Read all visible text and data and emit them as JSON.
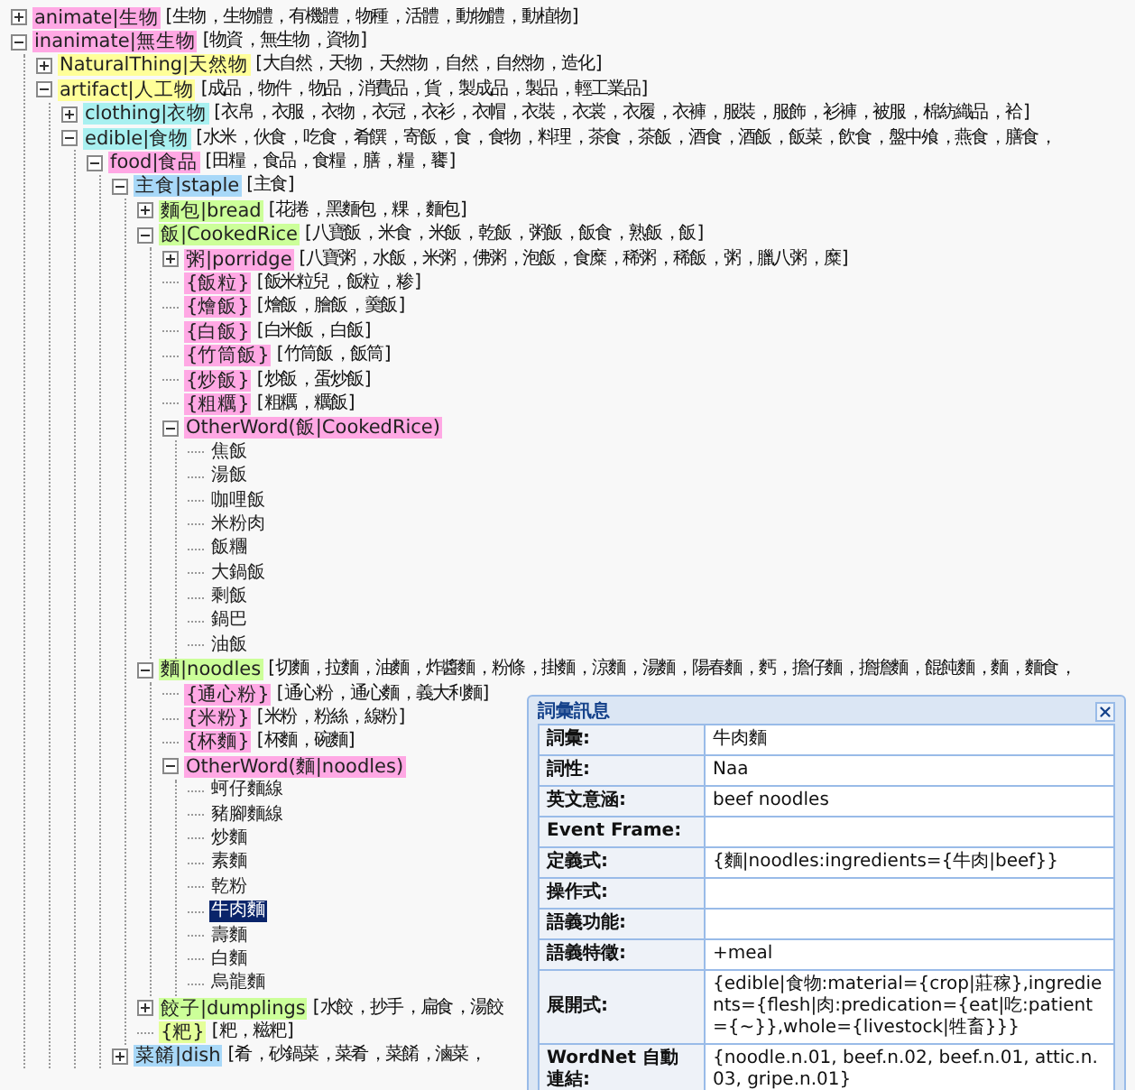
{
  "tree": [
    {
      "kind": "branch",
      "head": "animate|生物",
      "color": "#ffa8e4",
      "synonyms": "[ 生物 ，生物體 ，有機體 ，物種 ，活體 ，動物體 ，動植物 ]",
      "expanded": false,
      "selected": false
    },
    {
      "kind": "branch",
      "head": "inanimate|無生物",
      "color": "#ffa8e4",
      "synonyms": "[ 物資 ，無生物 ，資物 ]",
      "expanded": true,
      "selected": false,
      "children": [
        {
          "kind": "branch",
          "head": "NaturalThing|天然物",
          "color": "#ffff99",
          "synonyms": "[ 大自然 ，天物 ，天然物 ，自然 ，自然物 ，造化 ]",
          "expanded": false,
          "selected": false
        },
        {
          "kind": "branch",
          "head": "artifact|人工物",
          "color": "#ffff99",
          "synonyms": "[ 成品 ，物件 ，物品 ，消費品 ，貨 ，製成品 ，製品 ，輕工業品 ]",
          "expanded": true,
          "selected": false,
          "children": [
            {
              "kind": "branch",
              "head": "clothing|衣物",
              "color": "#a8f0f0",
              "synonyms": "[ 衣帛 ，衣服 ，衣物 ，衣冠 ，衣衫 ，衣帽 ，衣裝 ，衣裳 ，衣履 ，衣褲 ，服裝 ，服飾 ，衫褲 ，被服 ，棉紡織品 ，袷 ]",
              "expanded": false,
              "selected": false
            },
            {
              "kind": "branch",
              "head": "edible|食物",
              "color": "#a8f0f0",
              "synonyms": "[ 水米 ，伙食 ，吃食 ，肴饌 ，寄飯 ，食 ，食物 ，料理 ，茶食 ，茶飯 ，酒食 ，酒飯 ，飯菜 ，飲食 ，盤中飧 ，燕食 ，膳食 ，",
              "expanded": true,
              "selected": false,
              "children": [
                {
                  "kind": "branch",
                  "head": "food|食品",
                  "color": "#ffa8e4",
                  "synonyms": "[ 田糧 ，食品 ，食糧 ，膳 ，糧 ，饔 ]",
                  "expanded": true,
                  "selected": false,
                  "children": [
                    {
                      "kind": "branch",
                      "head": "主食|staple",
                      "color": "#a8d8f8",
                      "synonyms": "[ 主食 ]",
                      "expanded": true,
                      "selected": false,
                      "children": [
                        {
                          "kind": "branch",
                          "head": "麵包|bread",
                          "color": "#ccff99",
                          "synonyms": "[ 花捲 ，黑麵包 ，粿 ，麵包 ]",
                          "expanded": false,
                          "selected": false
                        },
                        {
                          "kind": "branch",
                          "head": "飯|CookedRice",
                          "color": "#ccff99",
                          "synonyms": "[ 八寶飯 ，米食 ，米飯 ，乾飯 ，粥飯 ，飯食 ，熟飯 ，飯 ]",
                          "expanded": true,
                          "selected": false,
                          "children": [
                            {
                              "kind": "branch",
                              "head": "粥|porridge",
                              "color": "#ffa8e4",
                              "synonyms": "[ 八寶粥 ，水飯 ，米粥 ，佛粥 ，泡飯 ，食糜 ，稀粥 ，稀飯 ，粥 ，臘八粥 ，糜 ]",
                              "expanded": false,
                              "selected": false
                            },
                            {
                              "kind": "leaf",
                              "head": "{飯粒}",
                              "color": "#ffa8e4",
                              "synonyms": "[ 飯米粒兒 ，飯粒 ，糁 ]",
                              "selected": false
                            },
                            {
                              "kind": "leaf",
                              "head": "{燴飯}",
                              "color": "#ffa8e4",
                              "synonyms": "[ 燴飯 ，膾飯 ，羹飯 ]",
                              "selected": false
                            },
                            {
                              "kind": "leaf",
                              "head": "{白飯}",
                              "color": "#ffa8e4",
                              "synonyms": "[ 白米飯 ，白飯 ]",
                              "selected": false
                            },
                            {
                              "kind": "leaf",
                              "head": "{竹筒飯}",
                              "color": "#ffa8e4",
                              "synonyms": "[ 竹筒飯 ，飯筒 ]",
                              "selected": false
                            },
                            {
                              "kind": "leaf",
                              "head": "{炒飯}",
                              "color": "#ffa8e4",
                              "synonyms": "[ 炒飯 ，蛋炒飯 ]",
                              "selected": false
                            },
                            {
                              "kind": "leaf",
                              "head": "{粗糲}",
                              "color": "#ffa8e4",
                              "synonyms": "[ 粗糲 ，糲飯 ]",
                              "selected": false
                            },
                            {
                              "kind": "branch",
                              "head": "OtherWord(飯|CookedRice)",
                              "color": "#ffa8e4",
                              "expanded": true,
                              "selected": false,
                              "children": [
                                {
                                  "kind": "word",
                                  "head": "焦飯",
                                  "selected": false
                                },
                                {
                                  "kind": "word",
                                  "head": "湯飯",
                                  "selected": false
                                },
                                {
                                  "kind": "word",
                                  "head": "咖哩飯",
                                  "selected": false
                                },
                                {
                                  "kind": "word",
                                  "head": "米粉肉",
                                  "selected": false
                                },
                                {
                                  "kind": "word",
                                  "head": "飯糰",
                                  "selected": false
                                },
                                {
                                  "kind": "word",
                                  "head": "大鍋飯",
                                  "selected": false
                                },
                                {
                                  "kind": "word",
                                  "head": "剩飯",
                                  "selected": false
                                },
                                {
                                  "kind": "word",
                                  "head": "鍋巴",
                                  "selected": false
                                },
                                {
                                  "kind": "word",
                                  "head": "油飯",
                                  "selected": false
                                }
                              ]
                            }
                          ]
                        },
                        {
                          "kind": "branch",
                          "head": "麵|noodles",
                          "color": "#ccff99",
                          "synonyms": "[ 切麵 ，拉麵 ，油麵 ，炸醬麵 ，粉條 ，掛麵 ，涼麵 ，湯麵 ，陽春麵 ，麫 ，擔仔麵 ，擔擔麵 ，餛飩麵 ，麵 ，麵食 ，",
                          "expanded": true,
                          "selected": false,
                          "children": [
                            {
                              "kind": "leaf",
                              "head": "{通心粉}",
                              "color": "#ffa8e4",
                              "synonyms": "[ 通心粉 ，通心麵 ，義大利麵 ]",
                              "selected": false
                            },
                            {
                              "kind": "leaf",
                              "head": "{米粉}",
                              "color": "#ffa8e4",
                              "synonyms": "[ 米粉 ，粉絲 ，線粉 ]",
                              "selected": false
                            },
                            {
                              "kind": "leaf",
                              "head": "{杯麵}",
                              "color": "#ffa8e4",
                              "synonyms": "[ 杯麵 ，碗麵 ]",
                              "selected": false
                            },
                            {
                              "kind": "branch",
                              "head": "OtherWord(麵|noodles)",
                              "color": "#ffa8e4",
                              "expanded": true,
                              "selected": false,
                              "children": [
                                {
                                  "kind": "word",
                                  "head": "蚵仔麵線",
                                  "selected": false
                                },
                                {
                                  "kind": "word",
                                  "head": "豬腳麵線",
                                  "selected": false
                                },
                                {
                                  "kind": "word",
                                  "head": "炒麵",
                                  "selected": false
                                },
                                {
                                  "kind": "word",
                                  "head": "素麵",
                                  "selected": false
                                },
                                {
                                  "kind": "word",
                                  "head": "乾粉",
                                  "selected": false
                                },
                                {
                                  "kind": "word",
                                  "head": "牛肉麵",
                                  "selected": true
                                },
                                {
                                  "kind": "word",
                                  "head": "壽麵",
                                  "selected": false
                                },
                                {
                                  "kind": "word",
                                  "head": "白麵",
                                  "selected": false
                                },
                                {
                                  "kind": "word",
                                  "head": "烏龍麵",
                                  "selected": false
                                }
                              ]
                            }
                          ]
                        },
                        {
                          "kind": "branch",
                          "head": "餃子|dumplings",
                          "color": "#ccff99",
                          "synonyms": "[ 水餃 ，抄手 ，扁食 ，湯餃",
                          "expanded": false,
                          "selected": false
                        },
                        {
                          "kind": "leaf",
                          "head": "{粑}",
                          "color": "#e4ff99",
                          "synonyms": "[ 粑 ，糍粑 ]",
                          "selected": false
                        }
                      ]
                    },
                    {
                      "kind": "branch",
                      "head": "菜餚|dish",
                      "color": "#a8d8f8",
                      "synonyms": "[ 肴 ，砂鍋菜 ，菜肴 ，菜餚 ，滷菜 ，",
                      "expanded": false,
                      "selected": false
                    }
                  ]
                }
              ]
            }
          ]
        }
      ]
    }
  ],
  "popup": {
    "title": "詞彙訊息",
    "rows": [
      {
        "label": "詞彙:",
        "value": "牛肉麵"
      },
      {
        "label": "詞性:",
        "value": "Naa"
      },
      {
        "label": "英文意涵:",
        "value": "beef noodles"
      },
      {
        "label": "Event Frame:"
      },
      {
        "label": "定義式:",
        "value": "{麵|noodles:ingredients={牛肉|beef}}"
      },
      {
        "label": "操作式:"
      },
      {
        "label": "語義功能:"
      },
      {
        "label": "語義特徵:",
        "value": "+meal"
      },
      {
        "label": "展開式:",
        "value": "{edible|食物:material={crop|莊稼},ingredients={flesh|肉:predication={eat|吃:patient={~}},whole={livestock|牲畜}}}"
      },
      {
        "label": "WordNet 自動連結:",
        "value": "{noodle.n.01, beef.n.02, beef.n.01, attic.n.03, gripe.n.01}"
      }
    ]
  }
}
